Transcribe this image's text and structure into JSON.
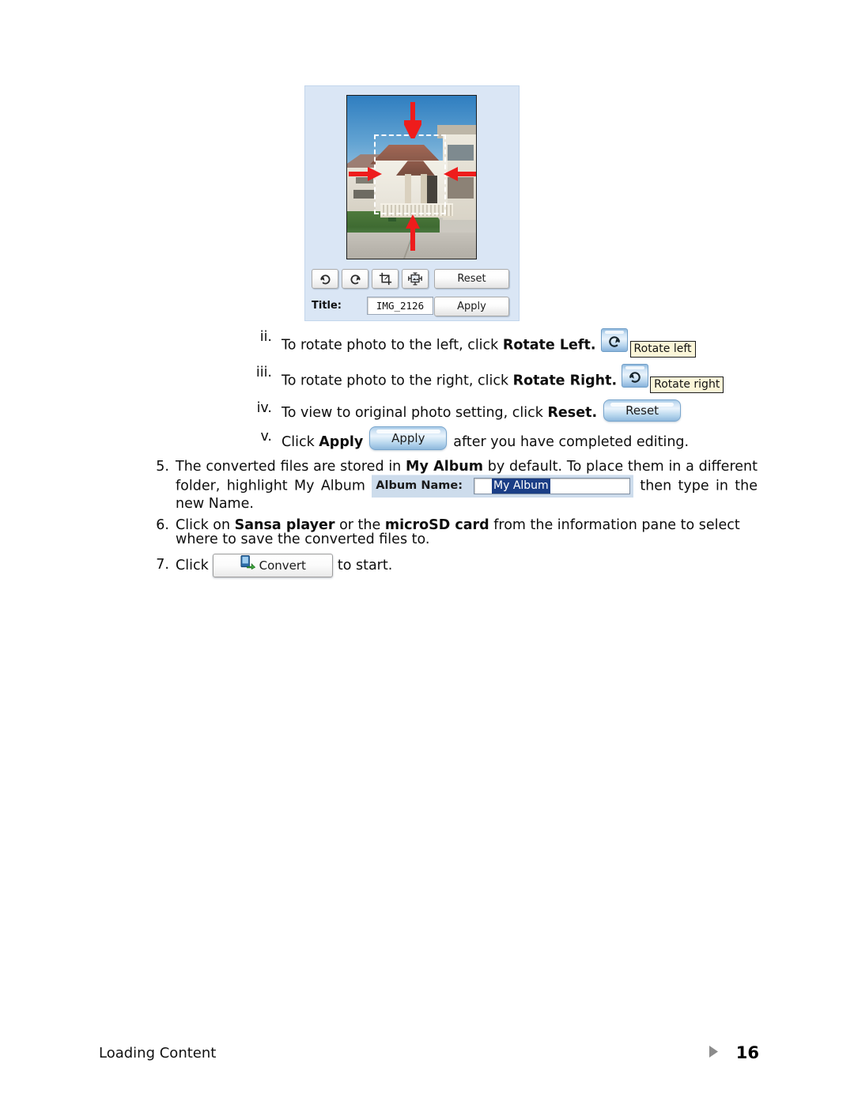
{
  "editor": {
    "photo": {
      "alt_description": "Two-story stucco house with red tile roof, blue sky, green lawn and concrete driveway",
      "crop_marquee": "dashed-crop-selection",
      "arrows": [
        "arrow-down-top",
        "arrow-right-left",
        "arrow-left-right",
        "arrow-up-bottom"
      ]
    },
    "toolbar": {
      "rotate_right_icon": "rotate-right-icon",
      "rotate_left_icon": "rotate-left-icon",
      "crop_icon": "crop-icon",
      "resize_icon": "resize-image-icon",
      "reset_label": "Reset"
    },
    "title_label": "Title:",
    "title_value": "IMG_2126",
    "apply_label": "Apply",
    "panel_bg": "#dae6f5"
  },
  "steps": {
    "ii": {
      "marker": "ii.",
      "text_before": "To rotate photo to the left, click ",
      "bold": "Rotate Left.",
      "button_icon": "rotate-left-icon",
      "tooltip": "Rotate left"
    },
    "iii": {
      "marker": "iii.",
      "text_before": "To rotate photo to the right, click ",
      "bold": "Rotate Right.",
      "button_icon": "rotate-right-icon",
      "tooltip": "Rotate right"
    },
    "iv": {
      "marker": "iv.",
      "text_before": "To view to original photo setting, click ",
      "bold": "Reset.",
      "button_label": "Reset"
    },
    "v": {
      "marker": "v.",
      "text_before": "Click ",
      "bold": "Apply",
      "button_label": "Apply",
      "text_after": "after you have completed editing."
    },
    "five": {
      "marker": "5.",
      "part1": "The converted files are stored in ",
      "bold1": "My Album",
      "part2": " by default.  To place them in a different folder, highlight My Album ",
      "album_label": "Album Name:",
      "album_value": "My Album",
      "part3": " then type in the new Name."
    },
    "six": {
      "marker": "6.",
      "part1": "Click on ",
      "bold1": "Sansa player",
      "part2": " or the ",
      "bold2": "microSD card",
      "part3": " from the information pane to select where to save the converted files to."
    },
    "seven": {
      "marker": "7.",
      "part1": "Click ",
      "button_label": "Convert",
      "button_icon": "convert-icon",
      "part2": " to start."
    }
  },
  "footer": {
    "left_text": "Loading Content",
    "triangle_icon": "triangle-right-icon",
    "page_number": "16"
  },
  "colors": {
    "panel_bg": "#dae6f5",
    "tooltip_bg": "#fbf6d8",
    "album_bar_bg": "#cddcec",
    "selection_blue": "#1b3e86",
    "arrow_red": "#ee1c1c",
    "footer_triangle": "#8c8c8c"
  }
}
